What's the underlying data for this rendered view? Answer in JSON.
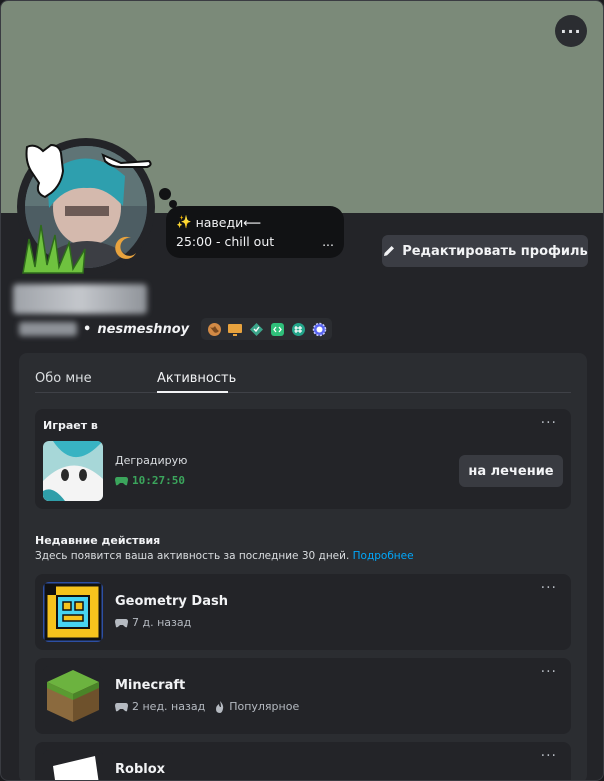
{
  "profile": {
    "status_line1": "наведи⟵",
    "status_emoji": "✨",
    "status_line2": "25:00 - chill out",
    "status_more": "...",
    "edit_label": "Редактировать профиль",
    "username": "nesmeshnoy",
    "username_separator": "•"
  },
  "tabs": [
    {
      "label": "Обо мне",
      "active": false
    },
    {
      "label": "Активность",
      "active": true
    }
  ],
  "playing": {
    "header": "Играет в",
    "activity_name": "Деградирую",
    "elapsed": "10:27:50",
    "button_label": "на лечение",
    "elapsed_color": "#3ba55c"
  },
  "recent": {
    "header": "Недавние действия",
    "subtitle": "Здесь появится ваша активность за последние 30 дней.",
    "link": "Подробнее",
    "items": [
      {
        "name": "Geometry Dash",
        "time": "7 д. назад",
        "tag": ""
      },
      {
        "name": "Minecraft",
        "time": "2 нед. назад",
        "tag": "Популярное"
      },
      {
        "name": "Roblox",
        "time": "",
        "tag": ""
      }
    ]
  },
  "colors": {
    "banner": "#7b8a79",
    "accent_link": "#00a8fc",
    "background": "#232428"
  },
  "icons": [
    "ellipsis-icon",
    "pencil-icon",
    "gamepad-icon",
    "flame-icon",
    "globe-icon",
    "monitor-icon",
    "diamond-icon",
    "code-icon",
    "hash-icon",
    "gear-icon"
  ]
}
